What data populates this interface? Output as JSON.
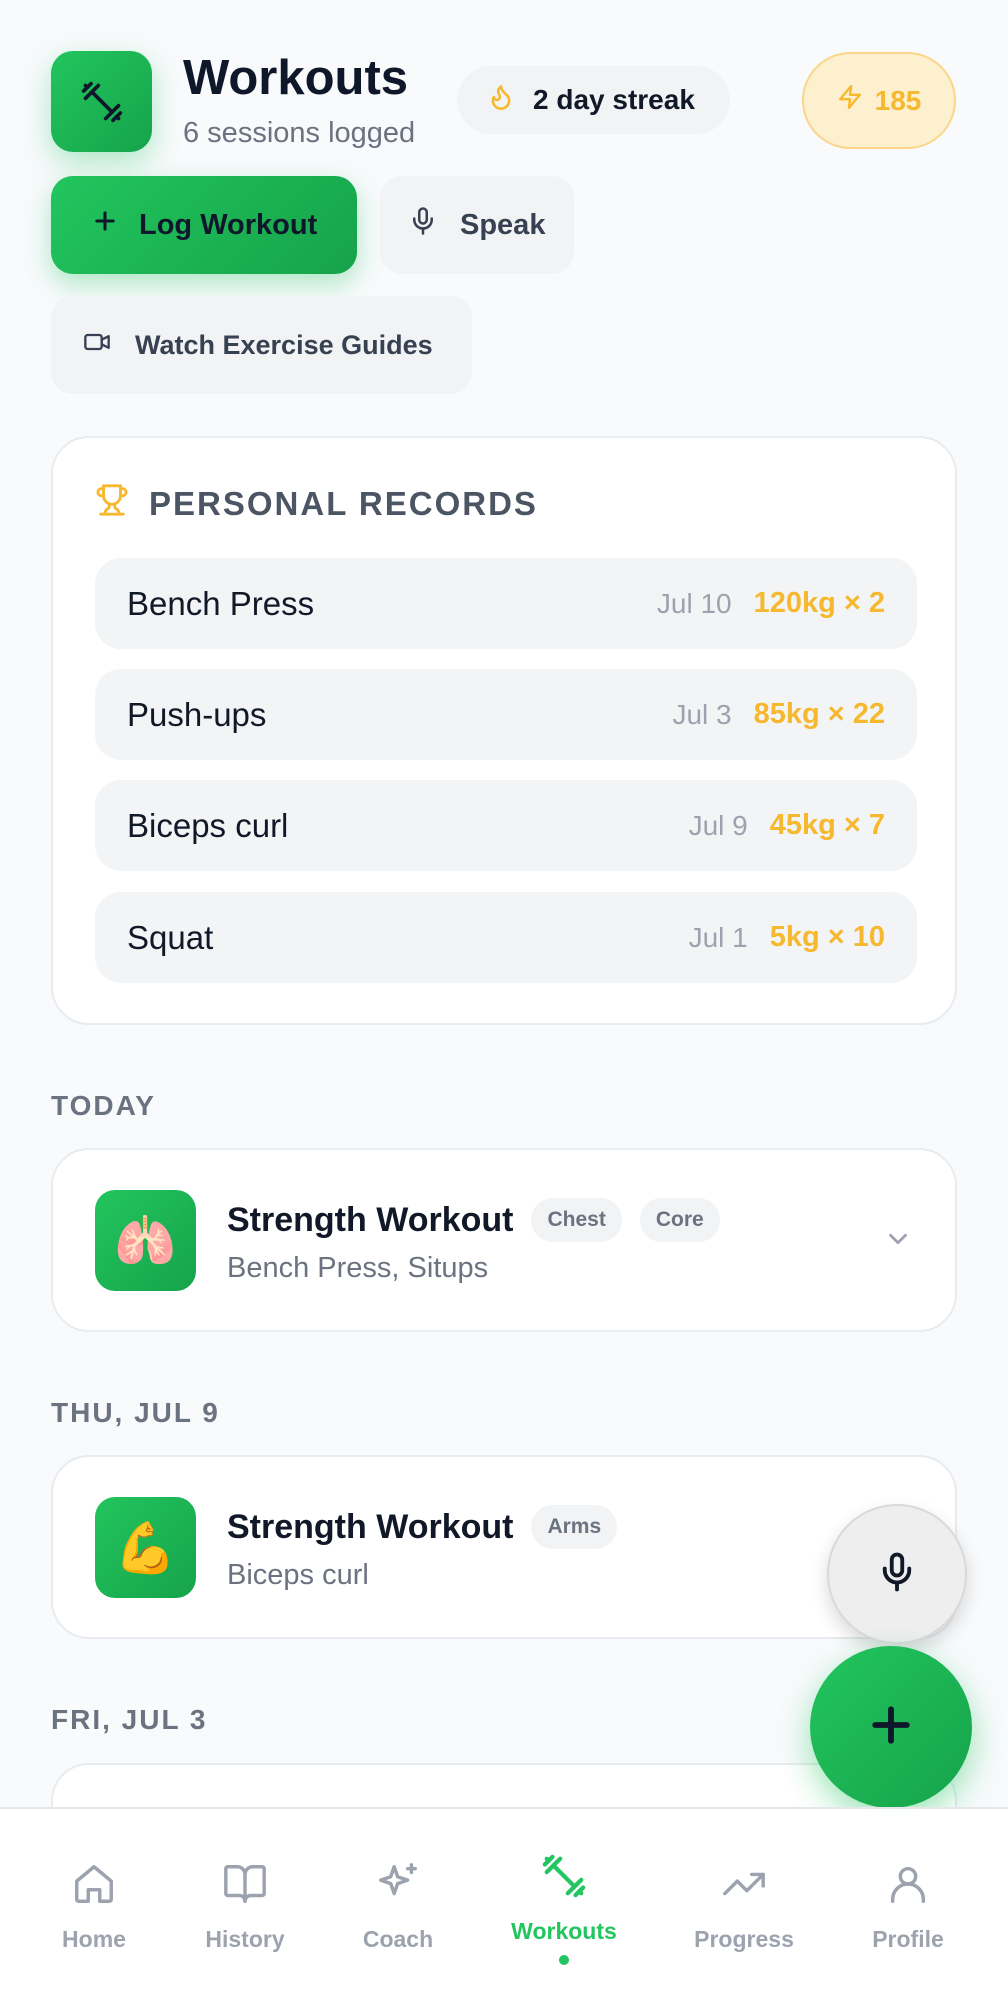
{
  "header": {
    "title": "Workouts",
    "subtitle": "6 sessions logged",
    "app_icon": "dumbbell-icon",
    "streak_label": "2 day streak",
    "streak_icon": "flame-icon",
    "points": "185",
    "points_icon": "lightning-icon"
  },
  "actions": {
    "log_workout": "Log Workout",
    "speak": "Speak",
    "watch_guides": "Watch Exercise Guides"
  },
  "records": {
    "heading": "PERSONAL RECORDS",
    "items": [
      {
        "name": "Bench Press",
        "date": "Jul 10",
        "value": "120kg × 2"
      },
      {
        "name": "Push-ups",
        "date": "Jul 3",
        "value": "85kg × 22"
      },
      {
        "name": "Biceps curl",
        "date": "Jul 9",
        "value": "45kg × 7"
      },
      {
        "name": "Squat",
        "date": "Jul 1",
        "value": "5kg × 10"
      }
    ]
  },
  "sections": [
    {
      "label": "TODAY",
      "workout": {
        "name": "Strength Workout",
        "emoji": "🫁",
        "tags": [
          "Chest",
          "Core"
        ],
        "exercises": "Bench Press, Situps"
      }
    },
    {
      "label": "THU, JUL 9",
      "workout": {
        "name": "Strength Workout",
        "emoji": "💪",
        "tags": [
          "Arms"
        ],
        "exercises": "Biceps curl"
      }
    },
    {
      "label": "FRI, JUL 3"
    }
  ],
  "nav": {
    "items": [
      {
        "label": "Home",
        "icon": "home-icon"
      },
      {
        "label": "History",
        "icon": "book-icon"
      },
      {
        "label": "Coach",
        "icon": "sparkle-icon"
      },
      {
        "label": "Workouts",
        "icon": "dumbbell-icon",
        "active": true
      },
      {
        "label": "Progress",
        "icon": "trending-up-icon"
      },
      {
        "label": "Profile",
        "icon": "user-icon"
      }
    ]
  },
  "colors": {
    "accent": "#22c55e",
    "accent_dark": "#16a34a",
    "gold": "#f5b82e"
  }
}
